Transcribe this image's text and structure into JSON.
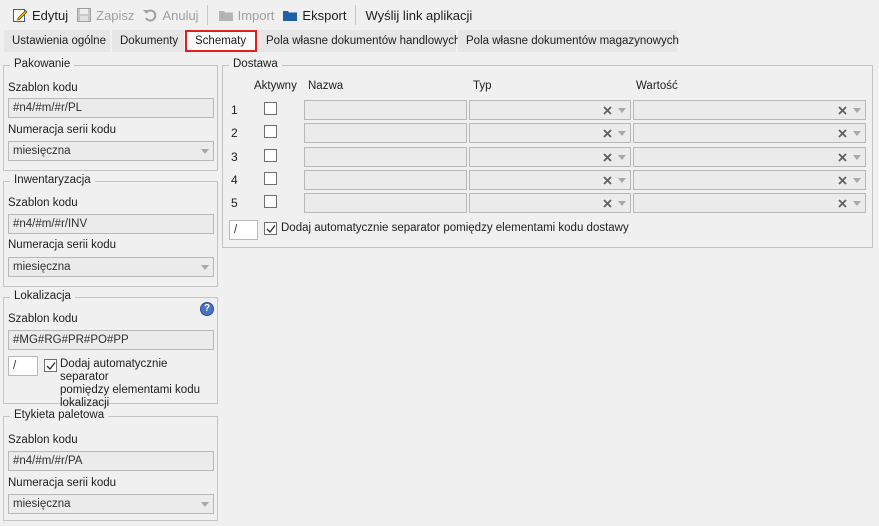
{
  "toolbar": {
    "edit_label": "Edytuj",
    "save_label": "Zapisz",
    "cancel_label": "Anuluj",
    "import_label": "Import",
    "export_label": "Eksport",
    "send_link_label": "Wyślij link aplikacji"
  },
  "tabs": [
    {
      "label": "Ustawienia ogólne"
    },
    {
      "label": "Dokumenty"
    },
    {
      "label": "Schematy"
    },
    {
      "label": "Pola własne dokumentów handlowych"
    },
    {
      "label": "Pola własne dokumentów magazynowych"
    }
  ],
  "active_tab": "Schematy",
  "pakowanie": {
    "title": "Pakowanie",
    "code_label": "Szablon kodu",
    "code_value": "#n4/#m/#r/PL",
    "series_label": "Numeracja serii kodu",
    "series_value": "miesięczna"
  },
  "inwentaryzacja": {
    "title": "Inwentaryzacja",
    "code_label": "Szablon kodu",
    "code_value": "#n4/#m/#r/INV",
    "series_label": "Numeracja serii kodu",
    "series_value": "miesięczna"
  },
  "lokalizacja": {
    "title": "Lokalizacja",
    "code_label": "Szablon kodu",
    "code_value": "#MG#RG#PR#PO#PP",
    "separator_value": "/",
    "auto_sep_line1": "Dodaj automatycznie separator",
    "auto_sep_line2": "pomiędzy elementami kodu",
    "auto_sep_line3": "lokalizacji",
    "auto_sep_checked": true
  },
  "etykieta": {
    "title": "Etykieta paletowa",
    "code_label": "Szablon kodu",
    "code_value": "#n4/#m/#r/PA",
    "series_label": "Numeracja serii kodu",
    "series_value": "miesięczna"
  },
  "dostawa": {
    "title": "Dostawa",
    "col_active": "Aktywny",
    "col_name": "Nazwa",
    "col_type": "Typ",
    "col_value": "Wartość",
    "rows": [
      {
        "num": "1",
        "active": false,
        "name": "",
        "type": "",
        "value": ""
      },
      {
        "num": "2",
        "active": false,
        "name": "",
        "type": "",
        "value": ""
      },
      {
        "num": "3",
        "active": false,
        "name": "",
        "type": "",
        "value": ""
      },
      {
        "num": "4",
        "active": false,
        "name": "",
        "type": "",
        "value": ""
      },
      {
        "num": "5",
        "active": false,
        "name": "",
        "type": "",
        "value": ""
      }
    ],
    "separator_value": "/",
    "auto_sep_label": "Dodaj automatycznie separator pomiędzy elementami kodu dostawy",
    "auto_sep_checked": true
  },
  "colors": {
    "active_tab_border": "#e02020",
    "help_icon": "#4a73c2",
    "export_icon": "#1f5fa8"
  },
  "icons": {
    "edit": "edit-pencil-icon",
    "save": "floppy-disk-icon",
    "cancel": "undo-arrow-icon",
    "import": "folder-icon",
    "export": "folder-icon",
    "help": "question-icon",
    "clear": "x-clear-icon",
    "dropdown": "chevron-down-icon",
    "check": "checkmark-icon"
  }
}
